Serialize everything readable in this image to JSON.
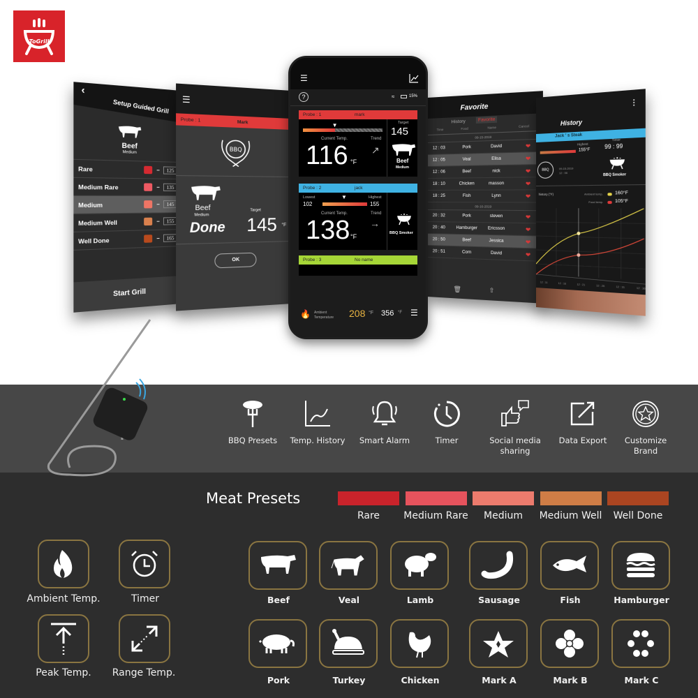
{
  "brand": {
    "logo_text": "ToGrill",
    "accent": "#d8232a"
  },
  "setup_screen": {
    "title": "Setup Guided Grill",
    "meat": "Beef",
    "doneness": "Medium",
    "rows": [
      {
        "label": "Rare",
        "value": "125",
        "color": "#d52a31"
      },
      {
        "label": "Medium Rare",
        "value": "135",
        "color": "#ee5a63"
      },
      {
        "label": "Medium",
        "value": "145",
        "color": "#ee7565",
        "selected": true
      },
      {
        "label": "Medium Well",
        "value": "155",
        "color": "#d9804d"
      },
      {
        "label": "Well Done",
        "value": "165",
        "color": "#b84a1d"
      }
    ],
    "start_button": "Start Grill"
  },
  "done_screen": {
    "probe": "Probe : 1",
    "name": "Mark",
    "badge": "BBQ",
    "meat": "Beef",
    "doneness": "Medium",
    "status": "Done",
    "target_label": "Target",
    "target": "145",
    "unit": "°F",
    "ok_button": "OK"
  },
  "phone": {
    "battery": "15%",
    "probes": [
      {
        "label": "Probe : 1",
        "name": "mark",
        "color": "#e03a3a",
        "current_label": "Current Temp.",
        "current": "116",
        "unit": "°F",
        "trend_label": "Trend",
        "trend": "↗",
        "target_label": "Target",
        "target": "145",
        "meat": "Beef",
        "doneness": "Medium",
        "progress": 0.4
      },
      {
        "label": "Probe : 2",
        "name": "jack",
        "color": "#3fb2e3",
        "lowest_label": "Lowest",
        "lowest": "102",
        "highest_label": "Highest",
        "highest": "155",
        "current_label": "Current Temp.",
        "current": "138",
        "unit": "°F",
        "trend_label": "Trend",
        "trend": "→",
        "device": "BBQ Smoker"
      },
      {
        "label": "Probe : 3",
        "name": "No name",
        "color": "#a6d637"
      }
    ],
    "ambient_label": "Ambient Temperature",
    "ambient": "208",
    "ambient_unit": "°F",
    "max": "356",
    "max_unit": "°F"
  },
  "favorite_screen": {
    "title": "Favorite",
    "tabs": [
      "History",
      "Favorite"
    ],
    "active_tab": "Favorite",
    "columns": [
      "Time",
      "Food",
      "Name",
      "Cancel"
    ],
    "groups": [
      {
        "date": "09-15-2019",
        "rows": [
          {
            "time": "12 : 03",
            "food": "Pork",
            "name": "David"
          },
          {
            "time": "12 : 05",
            "food": "Veal",
            "name": "Elisa",
            "selected": true
          },
          {
            "time": "12 : 06",
            "food": "Beef",
            "name": "nick"
          },
          {
            "time": "18 : 10",
            "food": "Chicken",
            "name": "masson"
          },
          {
            "time": "18 : 25",
            "food": "Fish",
            "name": "Lynn"
          }
        ]
      },
      {
        "date": "09-16-2019",
        "rows": [
          {
            "time": "20 : 32",
            "food": "Pork",
            "name": "steven"
          },
          {
            "time": "20 : 40",
            "food": "Hamburger",
            "name": "Ericsson"
          },
          {
            "time": "20 : 50",
            "food": "Beef",
            "name": "Jessica",
            "selected": true
          },
          {
            "time": "20 : 51",
            "food": "Corn",
            "name": "David"
          }
        ]
      }
    ]
  },
  "history_screen": {
    "title": "History",
    "session": "Jack ' s Steak",
    "highest_label": "Highest",
    "highest": "155°F",
    "timer_label": "Timer",
    "timer": "99 : 99",
    "date": "09-15-2019",
    "time": "12 : 06",
    "device": "BBQ Smoker",
    "chart_title": "history (°F)",
    "legend": [
      {
        "label": "Ambient temp.",
        "value": "160°F",
        "color": "#e6d44a"
      },
      {
        "label": "Food temp.",
        "value": "105°F",
        "color": "#e03a3a"
      }
    ],
    "x_ticks": [
      "12 : 11",
      "12 : 16",
      "12 : 21",
      "12 : 26",
      "12 : 31",
      "12 : 36"
    ]
  },
  "features": [
    {
      "icon": "bbq-presets-icon",
      "label": "BBQ Presets"
    },
    {
      "icon": "temp-history-icon",
      "label": "Temp. History"
    },
    {
      "icon": "smart-alarm-icon",
      "label": "Smart Alarm"
    },
    {
      "icon": "timer-icon",
      "label": "Timer"
    },
    {
      "icon": "social-share-icon",
      "label": "Social media sharing"
    },
    {
      "icon": "data-export-icon",
      "label": "Data Export"
    },
    {
      "icon": "customize-brand-icon",
      "label": "Customize Brand"
    }
  ],
  "meat_presets": {
    "title": "Meat Presets",
    "levels": [
      {
        "label": "Rare",
        "color": "#c9232b"
      },
      {
        "label": "Medium Rare",
        "color": "#e6535d"
      },
      {
        "label": "Medium",
        "color": "#ec7b6d"
      },
      {
        "label": "Medium Well",
        "color": "#cf7d46"
      },
      {
        "label": "Well Done",
        "color": "#ab4521"
      }
    ]
  },
  "modes": [
    "Ambient Temp.",
    "Timer",
    "Peak Temp.",
    "Range Temp."
  ],
  "foods": [
    "Beef",
    "Veal",
    "Lamb",
    "Sausage",
    "Fish",
    "Hamburger",
    "Pork",
    "Turkey",
    "Chicken",
    "Mark A",
    "Mark B",
    "Mark C"
  ],
  "tile_border": "#8a7541"
}
